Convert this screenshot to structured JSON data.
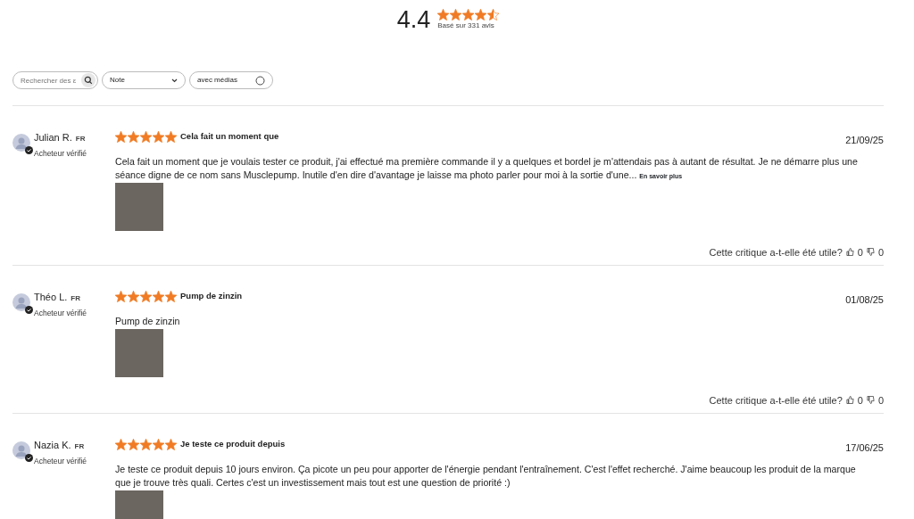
{
  "summary": {
    "rating": "4.4",
    "stars": 4.5,
    "caption": "Basé sur 331 avis"
  },
  "filters": {
    "search": {
      "placeholder": "Rechercher des ε"
    },
    "rating": {
      "value": "Note"
    },
    "media": {
      "label": "avec médias",
      "checked": false
    }
  },
  "reviews": [
    {
      "author": "Julian R.",
      "country": "FR",
      "badge": "Acheteur vérifié",
      "stars": 5,
      "title": "Cela fait un moment que",
      "date": "21/09/25",
      "body": "Cela fait un moment que je voulais tester ce produit, j'ai effectué ma première commande il y a quelques et bordel je m'attendais pas à autant de résultat. Je ne démarre plus une séance digne de ce nom sans Musclepump. Inutile d'en dire d'avantage je laisse ma photo parler pour moi à la sortie d'une...",
      "more": "En savoir plus",
      "helpful": {
        "question": "Cette critique a-t-elle été utile?",
        "up": "0",
        "down": "0"
      }
    },
    {
      "author": "Théo L.",
      "country": "FR",
      "badge": "Acheteur vérifié",
      "stars": 5,
      "title": "Pump de zinzin",
      "date": "01/08/25",
      "body": "Pump de zinzin",
      "helpful": {
        "question": "Cette critique a-t-elle été utile?",
        "up": "0",
        "down": "0"
      }
    },
    {
      "author": "Nazia K.",
      "country": "FR",
      "badge": "Acheteur vérifié",
      "stars": 5,
      "title": "Je teste ce produit depuis",
      "date": "17/06/25",
      "body": "Je teste ce produit depuis 10 jours environ. Ça picote un peu pour apporter de l'énergie pendant l'entraînement. C'est l'effet recherché. J'aime beaucoup les produit de la marque que je trouve très quali. Certes c'est un investissement mais tout est une question de priorité :)"
    }
  ]
}
